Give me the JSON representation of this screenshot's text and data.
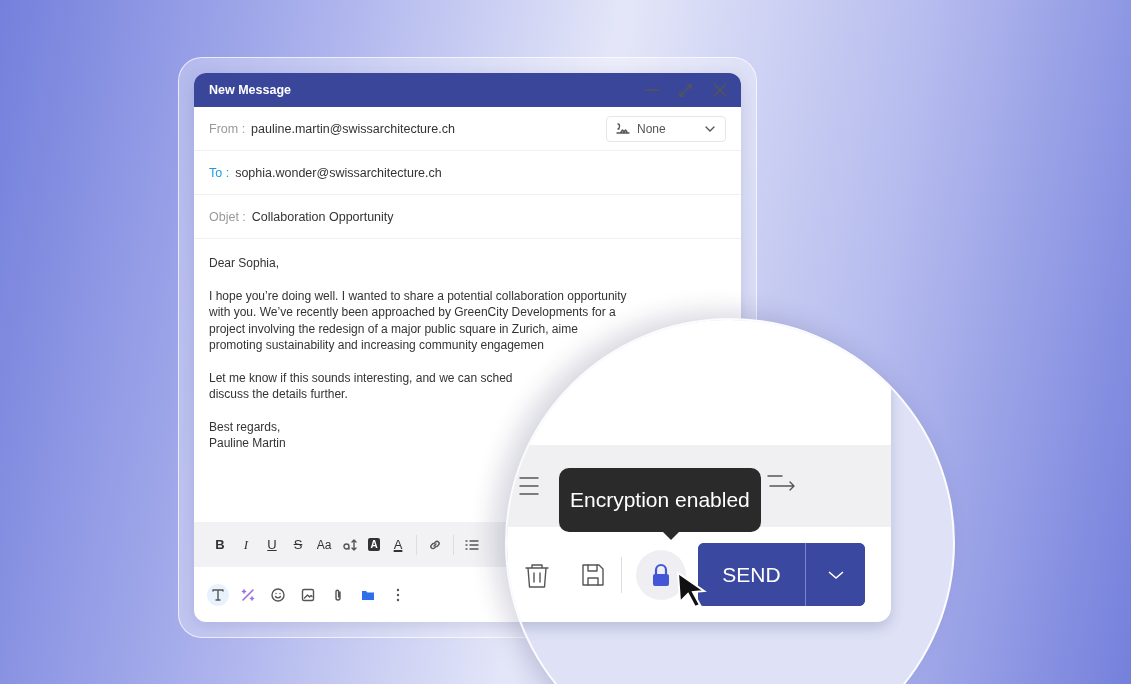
{
  "window": {
    "title": "New Message"
  },
  "fields": [
    {
      "kind": "from",
      "label": "From :",
      "value": "pauline.martin@swissarchitecture.ch",
      "signature": "None"
    },
    {
      "kind": "to",
      "label": "To :",
      "value": "sophia.wonder@swissarchitecture.ch"
    },
    {
      "kind": "subject",
      "label": "Objet :",
      "value": "Collaboration Opportunity"
    }
  ],
  "body": [
    [
      "Dear Sophia,"
    ],
    [
      "I hope you’re doing well. I wanted to share a potential collaboration opportunity",
      "with you. We’ve recently been approached by GreenCity Developments for a",
      "project involving the redesign of a major public square in Zurich, aime",
      "promoting sustainability and increasing community engagemen"
    ],
    [
      "Let me know if this sounds interesting, and we can sched",
      "discuss the details further."
    ],
    [
      "Best regards,",
      "Pauline Martin"
    ]
  ],
  "format_toolbar": [
    {
      "kind": "bold",
      "text": "B"
    },
    {
      "kind": "italic",
      "text": "I"
    },
    {
      "kind": "underline",
      "text": "U"
    },
    {
      "kind": "strike",
      "text": "S"
    },
    {
      "kind": "case",
      "text": "Aa"
    },
    {
      "kind": "size"
    },
    {
      "kind": "highlight",
      "text": "A"
    },
    {
      "kind": "color",
      "text": "A"
    },
    {
      "kind": "divider"
    },
    {
      "kind": "link"
    },
    {
      "kind": "divider"
    },
    {
      "kind": "list"
    }
  ],
  "bottom_tools": [
    {
      "kind": "text",
      "selected": true
    },
    {
      "kind": "ai",
      "selected": false
    },
    {
      "kind": "emoji",
      "selected": false
    },
    {
      "kind": "image",
      "selected": false
    },
    {
      "kind": "attach",
      "selected": false
    },
    {
      "kind": "folder",
      "selected": false
    },
    {
      "kind": "more",
      "selected": false
    }
  ],
  "magnifier": {
    "toolbar": [
      {
        "kind": "list"
      },
      {
        "kind": "indent"
      }
    ],
    "tooltip": "Encryption enabled",
    "encryption_on": true,
    "send_label": "SEND"
  }
}
